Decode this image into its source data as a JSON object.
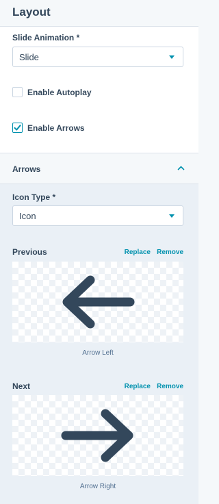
{
  "header": {
    "title": "Layout"
  },
  "slide_animation": {
    "label": "Slide Animation *",
    "value": "Slide"
  },
  "autoplay": {
    "label": "Enable Autoplay",
    "checked": false
  },
  "arrows_toggle": {
    "label": "Enable Arrows",
    "checked": true
  },
  "arrows_section": {
    "title": "Arrows",
    "icon_type": {
      "label": "Icon Type *",
      "value": "Icon"
    },
    "previous": {
      "label": "Previous",
      "replace": "Replace",
      "remove": "Remove",
      "caption": "Arrow Left",
      "icon": "arrow-left-icon"
    },
    "next": {
      "label": "Next",
      "replace": "Replace",
      "remove": "Remove",
      "caption": "Arrow Right",
      "icon": "arrow-right-icon"
    }
  },
  "colors": {
    "accent": "#0091ae",
    "text": "#33475b",
    "arrow": "#33475b",
    "panel_bg": "#eaf0f6"
  }
}
